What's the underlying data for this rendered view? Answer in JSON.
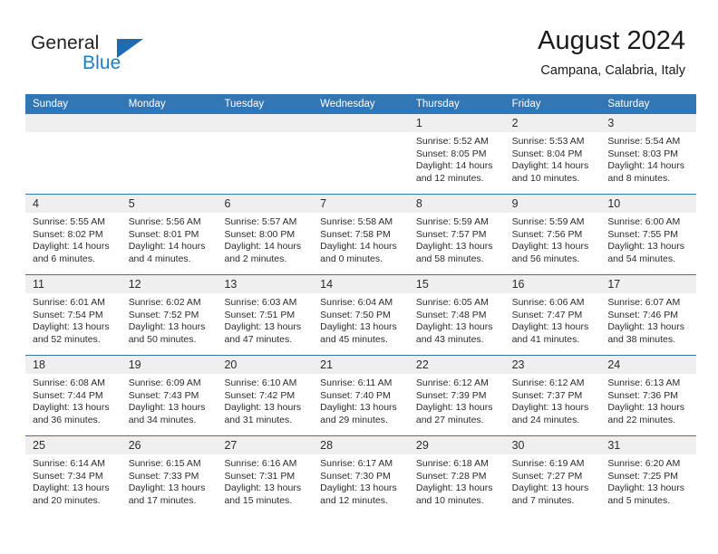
{
  "brand": {
    "name_part1": "General",
    "name_part2": "Blue",
    "triangle_color": "#1b6cb3",
    "blue_text_color": "#1b7fc4"
  },
  "header": {
    "title": "August 2024",
    "subtitle": "Campana, Calabria, Italy"
  },
  "theme": {
    "header_blue": "#3276b3",
    "band_gray": "#efefef",
    "text_color": "#2b2b2b"
  },
  "weekdays": [
    "Sunday",
    "Monday",
    "Tuesday",
    "Wednesday",
    "Thursday",
    "Friday",
    "Saturday"
  ],
  "weeks": [
    [
      {
        "day": "",
        "sunrise": "",
        "sunset": "",
        "daylight": "",
        "empty": true
      },
      {
        "day": "",
        "sunrise": "",
        "sunset": "",
        "daylight": "",
        "empty": true
      },
      {
        "day": "",
        "sunrise": "",
        "sunset": "",
        "daylight": "",
        "empty": true
      },
      {
        "day": "",
        "sunrise": "",
        "sunset": "",
        "daylight": "",
        "empty": true
      },
      {
        "day": "1",
        "sunrise": "Sunrise: 5:52 AM",
        "sunset": "Sunset: 8:05 PM",
        "daylight": "Daylight: 14 hours and 12 minutes."
      },
      {
        "day": "2",
        "sunrise": "Sunrise: 5:53 AM",
        "sunset": "Sunset: 8:04 PM",
        "daylight": "Daylight: 14 hours and 10 minutes."
      },
      {
        "day": "3",
        "sunrise": "Sunrise: 5:54 AM",
        "sunset": "Sunset: 8:03 PM",
        "daylight": "Daylight: 14 hours and 8 minutes."
      }
    ],
    [
      {
        "day": "4",
        "sunrise": "Sunrise: 5:55 AM",
        "sunset": "Sunset: 8:02 PM",
        "daylight": "Daylight: 14 hours and 6 minutes."
      },
      {
        "day": "5",
        "sunrise": "Sunrise: 5:56 AM",
        "sunset": "Sunset: 8:01 PM",
        "daylight": "Daylight: 14 hours and 4 minutes."
      },
      {
        "day": "6",
        "sunrise": "Sunrise: 5:57 AM",
        "sunset": "Sunset: 8:00 PM",
        "daylight": "Daylight: 14 hours and 2 minutes."
      },
      {
        "day": "7",
        "sunrise": "Sunrise: 5:58 AM",
        "sunset": "Sunset: 7:58 PM",
        "daylight": "Daylight: 14 hours and 0 minutes."
      },
      {
        "day": "8",
        "sunrise": "Sunrise: 5:59 AM",
        "sunset": "Sunset: 7:57 PM",
        "daylight": "Daylight: 13 hours and 58 minutes."
      },
      {
        "day": "9",
        "sunrise": "Sunrise: 5:59 AM",
        "sunset": "Sunset: 7:56 PM",
        "daylight": "Daylight: 13 hours and 56 minutes."
      },
      {
        "day": "10",
        "sunrise": "Sunrise: 6:00 AM",
        "sunset": "Sunset: 7:55 PM",
        "daylight": "Daylight: 13 hours and 54 minutes."
      }
    ],
    [
      {
        "day": "11",
        "sunrise": "Sunrise: 6:01 AM",
        "sunset": "Sunset: 7:54 PM",
        "daylight": "Daylight: 13 hours and 52 minutes."
      },
      {
        "day": "12",
        "sunrise": "Sunrise: 6:02 AM",
        "sunset": "Sunset: 7:52 PM",
        "daylight": "Daylight: 13 hours and 50 minutes."
      },
      {
        "day": "13",
        "sunrise": "Sunrise: 6:03 AM",
        "sunset": "Sunset: 7:51 PM",
        "daylight": "Daylight: 13 hours and 47 minutes."
      },
      {
        "day": "14",
        "sunrise": "Sunrise: 6:04 AM",
        "sunset": "Sunset: 7:50 PM",
        "daylight": "Daylight: 13 hours and 45 minutes."
      },
      {
        "day": "15",
        "sunrise": "Sunrise: 6:05 AM",
        "sunset": "Sunset: 7:48 PM",
        "daylight": "Daylight: 13 hours and 43 minutes."
      },
      {
        "day": "16",
        "sunrise": "Sunrise: 6:06 AM",
        "sunset": "Sunset: 7:47 PM",
        "daylight": "Daylight: 13 hours and 41 minutes."
      },
      {
        "day": "17",
        "sunrise": "Sunrise: 6:07 AM",
        "sunset": "Sunset: 7:46 PM",
        "daylight": "Daylight: 13 hours and 38 minutes."
      }
    ],
    [
      {
        "day": "18",
        "sunrise": "Sunrise: 6:08 AM",
        "sunset": "Sunset: 7:44 PM",
        "daylight": "Daylight: 13 hours and 36 minutes."
      },
      {
        "day": "19",
        "sunrise": "Sunrise: 6:09 AM",
        "sunset": "Sunset: 7:43 PM",
        "daylight": "Daylight: 13 hours and 34 minutes."
      },
      {
        "day": "20",
        "sunrise": "Sunrise: 6:10 AM",
        "sunset": "Sunset: 7:42 PM",
        "daylight": "Daylight: 13 hours and 31 minutes."
      },
      {
        "day": "21",
        "sunrise": "Sunrise: 6:11 AM",
        "sunset": "Sunset: 7:40 PM",
        "daylight": "Daylight: 13 hours and 29 minutes."
      },
      {
        "day": "22",
        "sunrise": "Sunrise: 6:12 AM",
        "sunset": "Sunset: 7:39 PM",
        "daylight": "Daylight: 13 hours and 27 minutes."
      },
      {
        "day": "23",
        "sunrise": "Sunrise: 6:12 AM",
        "sunset": "Sunset: 7:37 PM",
        "daylight": "Daylight: 13 hours and 24 minutes."
      },
      {
        "day": "24",
        "sunrise": "Sunrise: 6:13 AM",
        "sunset": "Sunset: 7:36 PM",
        "daylight": "Daylight: 13 hours and 22 minutes."
      }
    ],
    [
      {
        "day": "25",
        "sunrise": "Sunrise: 6:14 AM",
        "sunset": "Sunset: 7:34 PM",
        "daylight": "Daylight: 13 hours and 20 minutes."
      },
      {
        "day": "26",
        "sunrise": "Sunrise: 6:15 AM",
        "sunset": "Sunset: 7:33 PM",
        "daylight": "Daylight: 13 hours and 17 minutes."
      },
      {
        "day": "27",
        "sunrise": "Sunrise: 6:16 AM",
        "sunset": "Sunset: 7:31 PM",
        "daylight": "Daylight: 13 hours and 15 minutes."
      },
      {
        "day": "28",
        "sunrise": "Sunrise: 6:17 AM",
        "sunset": "Sunset: 7:30 PM",
        "daylight": "Daylight: 13 hours and 12 minutes."
      },
      {
        "day": "29",
        "sunrise": "Sunrise: 6:18 AM",
        "sunset": "Sunset: 7:28 PM",
        "daylight": "Daylight: 13 hours and 10 minutes."
      },
      {
        "day": "30",
        "sunrise": "Sunrise: 6:19 AM",
        "sunset": "Sunset: 7:27 PM",
        "daylight": "Daylight: 13 hours and 7 minutes."
      },
      {
        "day": "31",
        "sunrise": "Sunrise: 6:20 AM",
        "sunset": "Sunset: 7:25 PM",
        "daylight": "Daylight: 13 hours and 5 minutes."
      }
    ]
  ]
}
